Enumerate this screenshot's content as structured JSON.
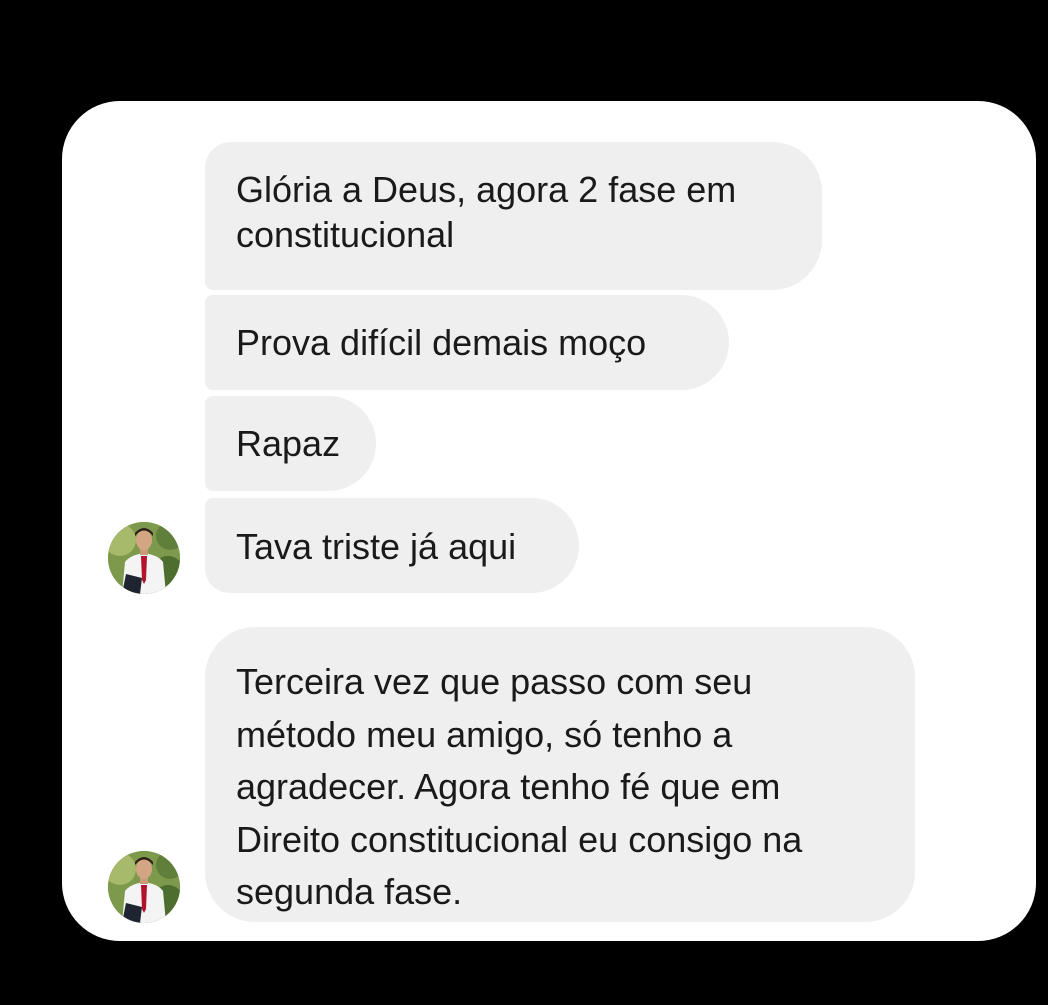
{
  "conversation": {
    "messages": [
      {
        "text": "Glória a Deus, agora 2 fase em\nconstitucional"
      },
      {
        "text": "Prova difícil demais moço"
      },
      {
        "text": "Rapaz"
      },
      {
        "text": "Tava triste já aqui"
      },
      {
        "text": "Terceira vez que passo com seu\nmétodo meu amigo, só tenho a\nagradecer. Agora tenho fé que em\nDireito constitucional eu consigo na\nsegunda fase."
      }
    ]
  },
  "colors": {
    "background": "#000000",
    "card": "#ffffff",
    "bubble": "#efefef",
    "text": "#1a1a1a"
  },
  "icons": {
    "avatar": "sender-profile-photo"
  }
}
